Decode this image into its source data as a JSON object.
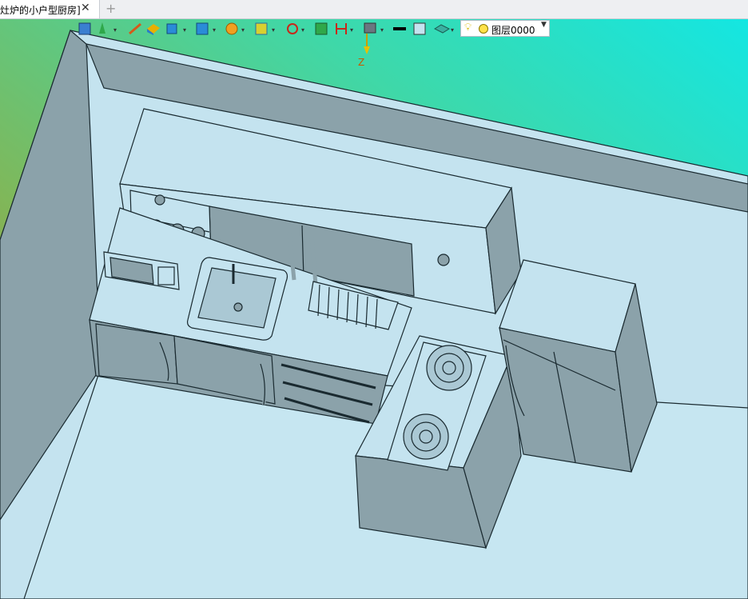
{
  "tab": {
    "title": "灶炉的小户型厨房]",
    "close_glyph": "✕",
    "new_glyph": "+"
  },
  "toolbar": {
    "axis_z_label": "Z"
  },
  "layer": {
    "name": "图层0000"
  }
}
